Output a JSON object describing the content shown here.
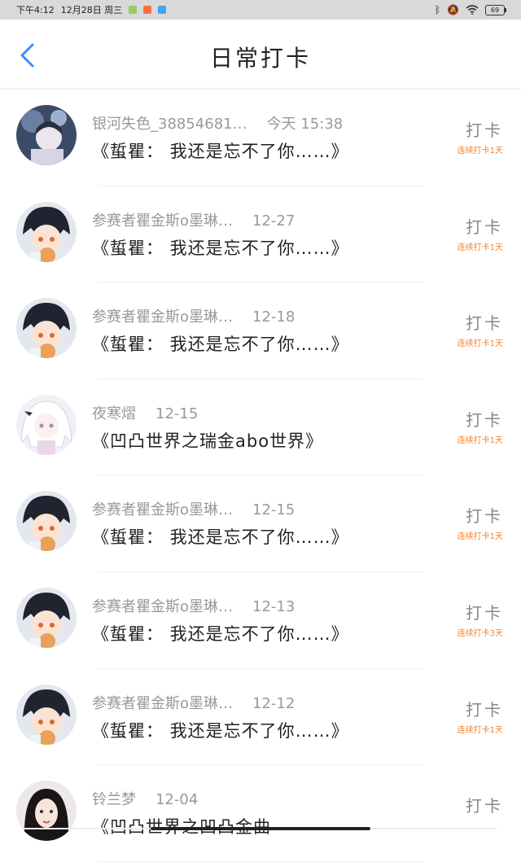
{
  "status_bar": {
    "time": "下午4:12",
    "date": "12月28日 周三",
    "battery": "69"
  },
  "header": {
    "title": "日常打卡"
  },
  "items": [
    {
      "user": "银河失色_38854681…",
      "date": "今天 15:38",
      "content": "《蜇瞿： 我还是忘不了你……》",
      "checkin": "打卡",
      "streak": "连续打卡1天"
    },
    {
      "user": "参赛者瞿金斯o墨琳…",
      "date": "12-27",
      "content": "《蜇瞿： 我还是忘不了你……》",
      "checkin": "打卡",
      "streak": "连续打卡1天"
    },
    {
      "user": "参赛者瞿金斯o墨琳…",
      "date": "12-18",
      "content": "《蜇瞿： 我还是忘不了你……》",
      "checkin": "打卡",
      "streak": "连续打卡1天"
    },
    {
      "user": "夜寒熠",
      "date": "12-15",
      "content": "《凹凸世界之瑞金abo世界》",
      "checkin": "打卡",
      "streak": "连续打卡1天"
    },
    {
      "user": "参赛者瞿金斯o墨琳…",
      "date": "12-15",
      "content": "《蜇瞿： 我还是忘不了你……》",
      "checkin": "打卡",
      "streak": "连续打卡1天"
    },
    {
      "user": "参赛者瞿金斯o墨琳…",
      "date": "12-13",
      "content": "《蜇瞿： 我还是忘不了你……》",
      "checkin": "打卡",
      "streak": "连续打卡3天"
    },
    {
      "user": "参赛者瞿金斯o墨琳…",
      "date": "12-12",
      "content": "《蜇瞿： 我还是忘不了你……》",
      "checkin": "打卡",
      "streak": "连续打卡1天"
    },
    {
      "user": "铃兰梦",
      "date": "12-04",
      "content": "《凹凸世界之凹凸金曲",
      "checkin": "打卡",
      "streak": ""
    }
  ]
}
